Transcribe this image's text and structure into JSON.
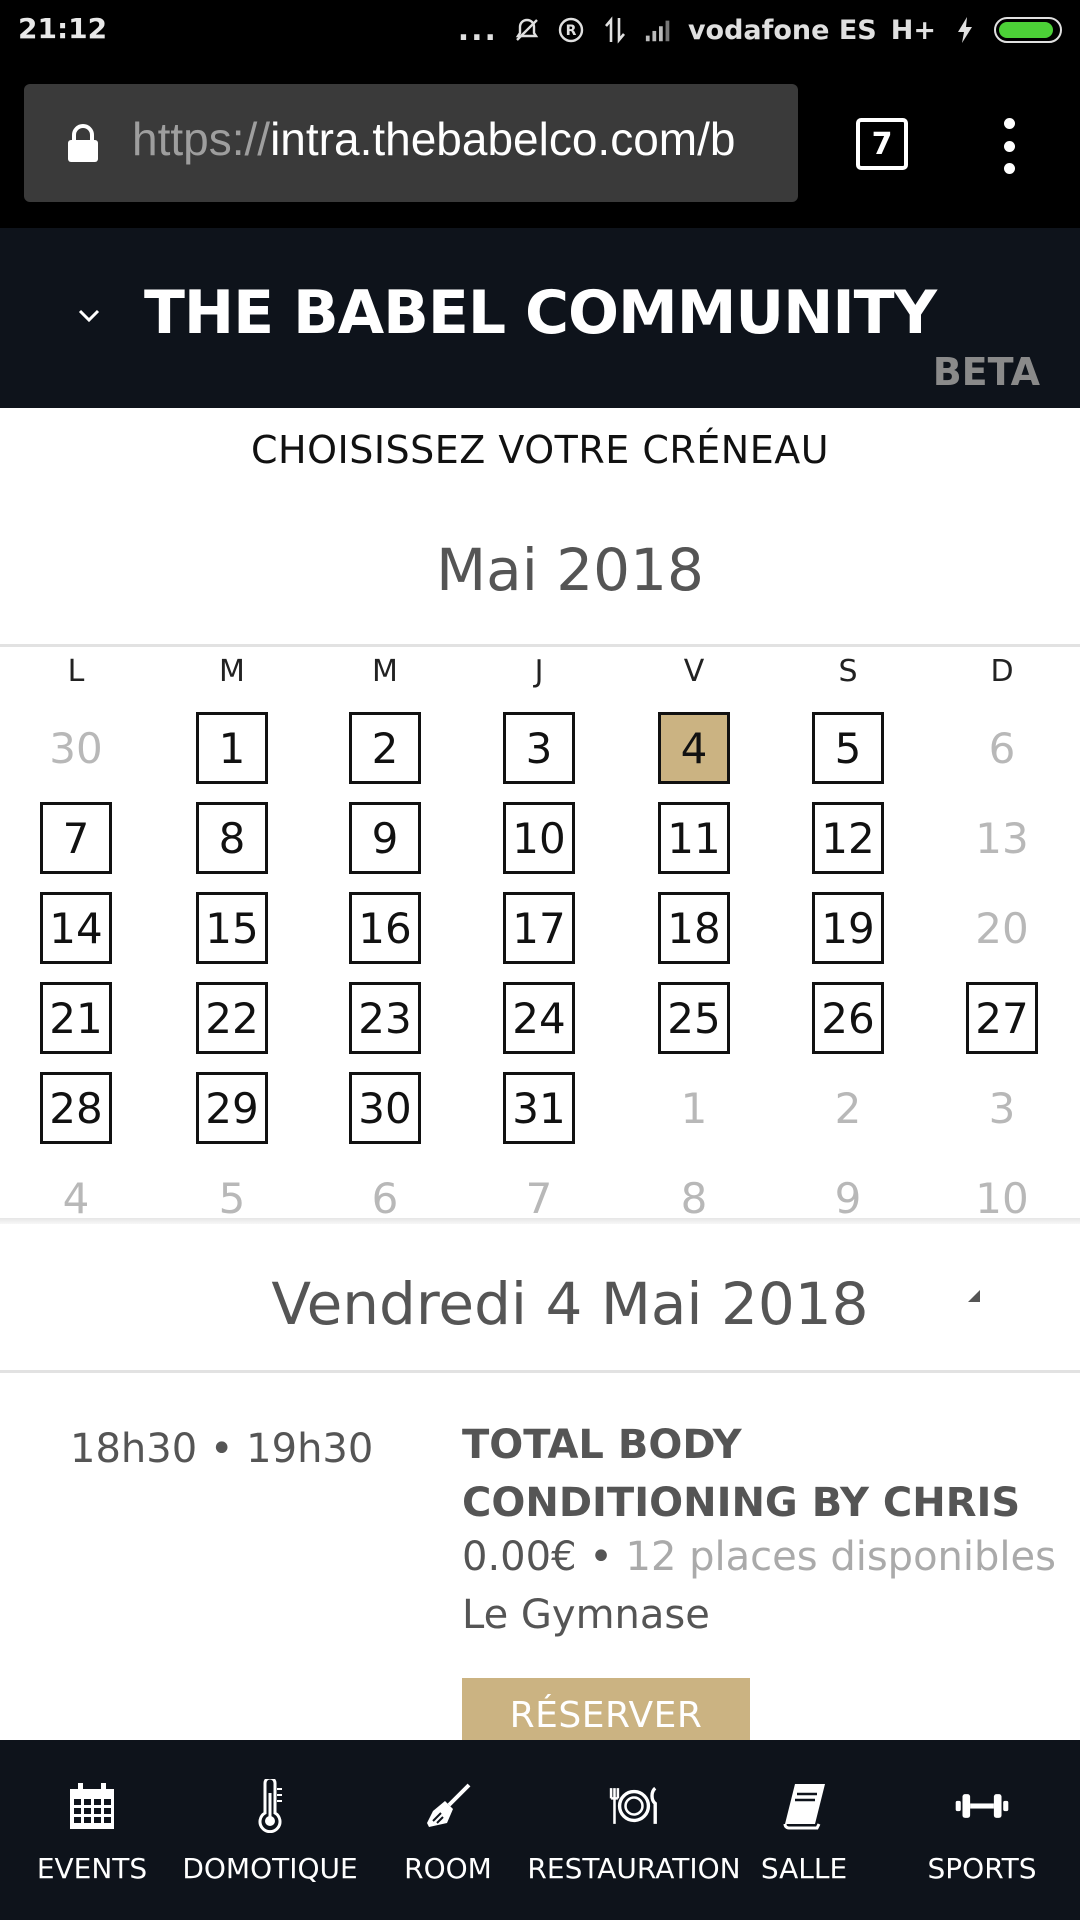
{
  "statusbar": {
    "time": "21:12",
    "dots": "...",
    "carrier": "vodafone ES",
    "network": "H+"
  },
  "browser": {
    "url_scheme": "https://",
    "url_host": "intra.thebabelco.com/b",
    "tab_count": "7"
  },
  "header": {
    "title": "THE BABEL COMMUNITY",
    "beta": "BETA"
  },
  "page": {
    "subtitle": "CHOISISSEZ VOTRE CRÉNEAU",
    "month": "Mai 2018",
    "weekdays": [
      "L",
      "M",
      "M",
      "J",
      "V",
      "S",
      "D"
    ],
    "weeks": [
      [
        {
          "d": "30",
          "s": "muted"
        },
        {
          "d": "1",
          "s": "boxed"
        },
        {
          "d": "2",
          "s": "boxed"
        },
        {
          "d": "3",
          "s": "boxed"
        },
        {
          "d": "4",
          "s": "selected"
        },
        {
          "d": "5",
          "s": "boxed"
        },
        {
          "d": "6",
          "s": "muted"
        }
      ],
      [
        {
          "d": "7",
          "s": "boxed"
        },
        {
          "d": "8",
          "s": "boxed"
        },
        {
          "d": "9",
          "s": "boxed"
        },
        {
          "d": "10",
          "s": "boxed"
        },
        {
          "d": "11",
          "s": "boxed"
        },
        {
          "d": "12",
          "s": "boxed"
        },
        {
          "d": "13",
          "s": "muted"
        }
      ],
      [
        {
          "d": "14",
          "s": "boxed"
        },
        {
          "d": "15",
          "s": "boxed"
        },
        {
          "d": "16",
          "s": "boxed"
        },
        {
          "d": "17",
          "s": "boxed"
        },
        {
          "d": "18",
          "s": "boxed"
        },
        {
          "d": "19",
          "s": "boxed"
        },
        {
          "d": "20",
          "s": "muted"
        }
      ],
      [
        {
          "d": "21",
          "s": "boxed"
        },
        {
          "d": "22",
          "s": "boxed"
        },
        {
          "d": "23",
          "s": "boxed"
        },
        {
          "d": "24",
          "s": "boxed"
        },
        {
          "d": "25",
          "s": "boxed"
        },
        {
          "d": "26",
          "s": "boxed"
        },
        {
          "d": "27",
          "s": "boxed"
        }
      ],
      [
        {
          "d": "28",
          "s": "boxed"
        },
        {
          "d": "29",
          "s": "boxed"
        },
        {
          "d": "30",
          "s": "boxed"
        },
        {
          "d": "31",
          "s": "boxed"
        },
        {
          "d": "1",
          "s": "muted"
        },
        {
          "d": "2",
          "s": "muted"
        },
        {
          "d": "3",
          "s": "muted"
        }
      ],
      [
        {
          "d": "4",
          "s": "muted"
        },
        {
          "d": "5",
          "s": "muted"
        },
        {
          "d": "6",
          "s": "muted"
        },
        {
          "d": "7",
          "s": "muted"
        },
        {
          "d": "8",
          "s": "muted"
        },
        {
          "d": "9",
          "s": "muted"
        },
        {
          "d": "10",
          "s": "muted"
        }
      ]
    ],
    "selected_day_label": "Vendredi 4 Mai 2018"
  },
  "event": {
    "time": "18h30 • 19h30",
    "title": "TOTAL BODY CONDITIONING BY CHRIS",
    "price": "0.00€ •",
    "places": "12 places disponibles",
    "location": "Le Gymnase",
    "reserve_label": "RÉSERVER"
  },
  "nav": {
    "items": [
      {
        "label": "EVENTS",
        "icon": "calendar-icon"
      },
      {
        "label": "DOMOTIQUE",
        "icon": "thermometer-icon"
      },
      {
        "label": "ROOM",
        "icon": "broom-icon"
      },
      {
        "label": "RESTAURATION",
        "icon": "dining-icon"
      },
      {
        "label": "SALLE",
        "icon": "book-icon"
      },
      {
        "label": "SPORTS",
        "icon": "dumbbell-icon"
      }
    ]
  },
  "colors": {
    "header_bg": "#0e131b",
    "accent_gold": "#cbb382",
    "muted_text": "#b8b8b8"
  }
}
